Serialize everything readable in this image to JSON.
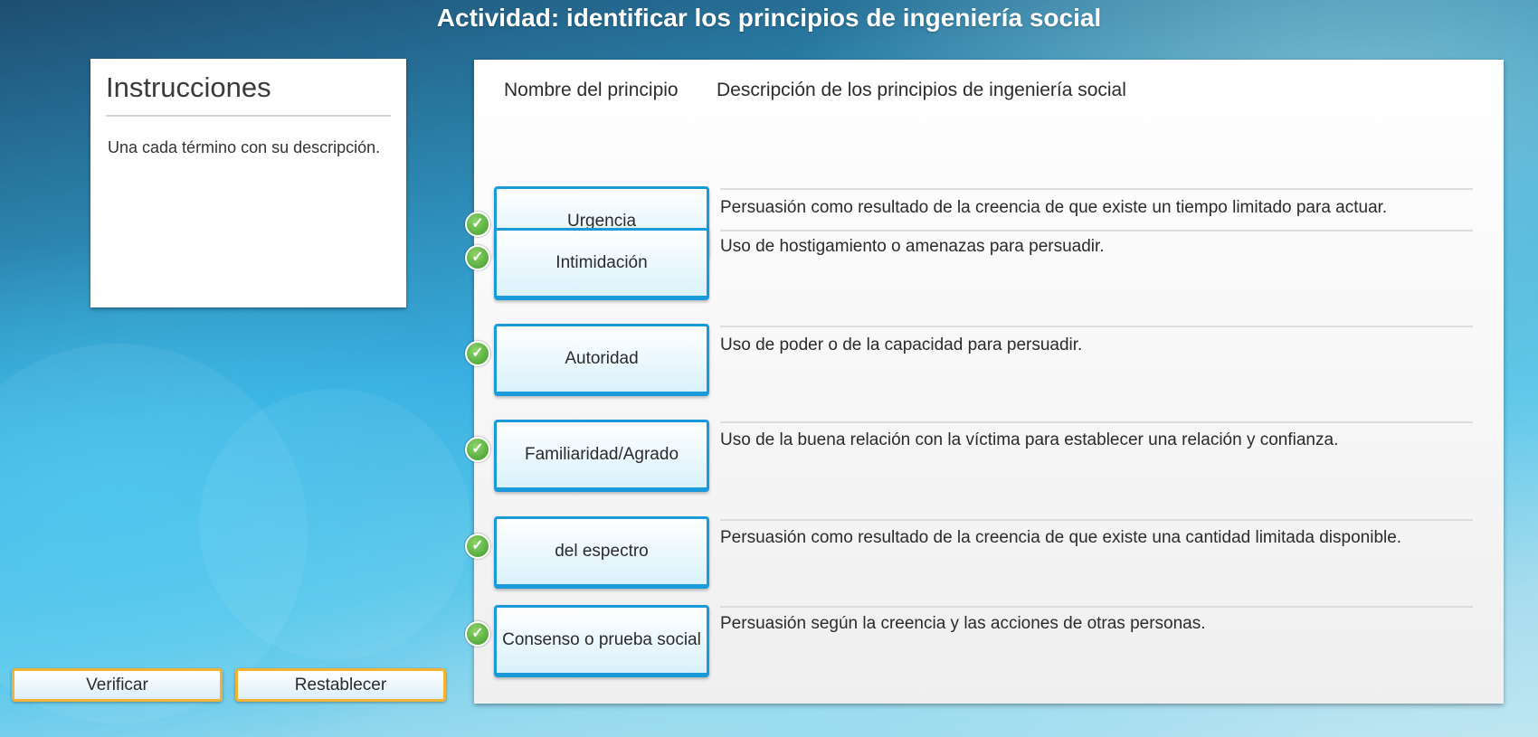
{
  "page": {
    "title": "Actividad: identificar los principios de ingeniería social"
  },
  "instructions": {
    "heading": "Instrucciones",
    "text": "Una cada término con su descripción."
  },
  "table": {
    "header_name": "Nombre del principio",
    "header_description": "Descripción de los principios de ingeniería social",
    "rows": [
      {
        "term": "Urgencia",
        "description": "Persuasión como resultado de la creencia de que existe un tiempo limitado para actuar.",
        "status": "correct"
      },
      {
        "term": "Intimidación",
        "description": "Uso de hostigamiento o amenazas para persuadir.",
        "status": "correct"
      },
      {
        "term": "Autoridad",
        "description": "Uso de poder o de la capacidad para persuadir.",
        "status": "correct"
      },
      {
        "term": "Familiaridad/Agrado",
        "description": "Uso de la buena relación con la víctima para establecer una relación y confianza.",
        "status": "correct"
      },
      {
        "term": "del espectro",
        "description": "Persuasión como resultado de la creencia de que existe una cantidad limitada disponible.",
        "status": "correct"
      },
      {
        "term": "Consenso o prueba social",
        "description": "Persuasión según la creencia y las acciones de otras personas.",
        "status": "correct"
      }
    ]
  },
  "actions": {
    "verify_label": "Verificar",
    "reset_label": "Restablecer"
  },
  "colors": {
    "accent_blue": "#1a9ad8",
    "check_green": "#3f9a2a",
    "button_border_orange": "#f2b233"
  },
  "icons": {
    "status_correct": "checkmark-icon"
  }
}
